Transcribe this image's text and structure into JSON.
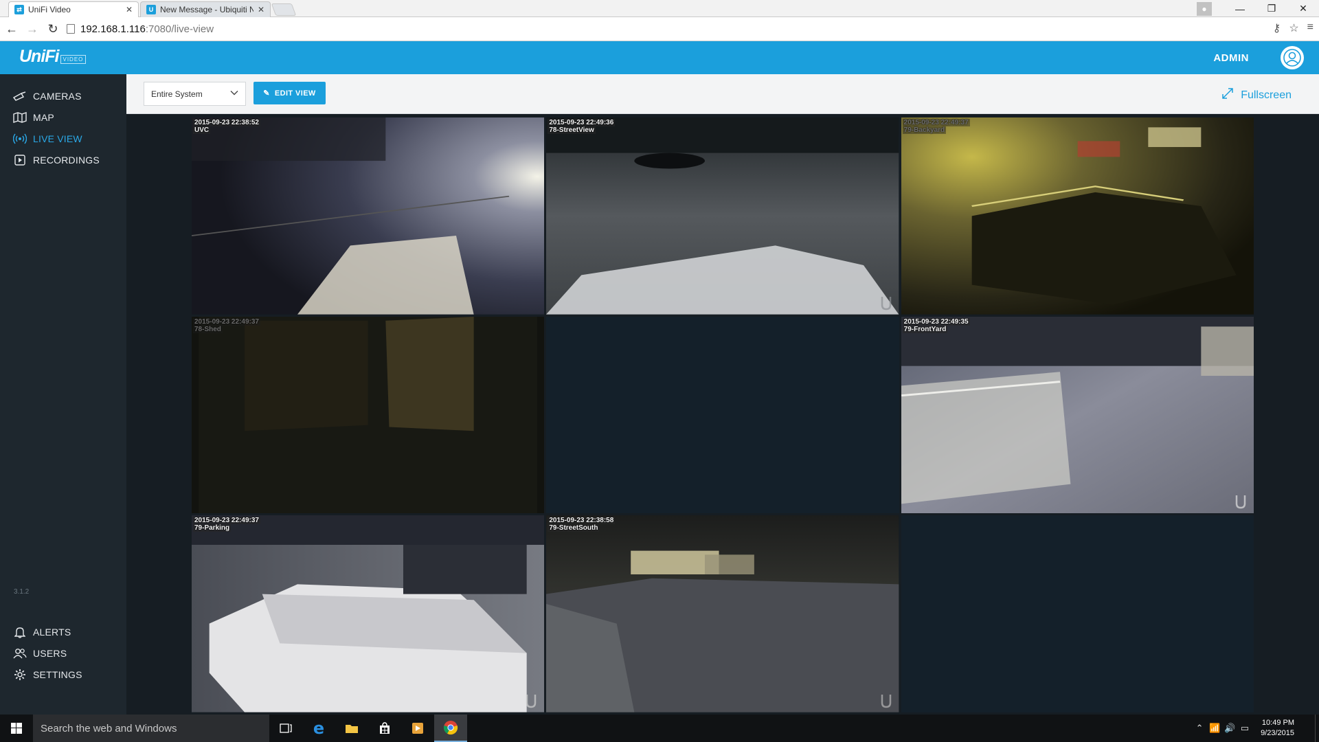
{
  "browser": {
    "tabs": [
      {
        "label": "UniFi Video",
        "favicon": "unifi-icon",
        "active": true
      },
      {
        "label": "New Message - Ubiquiti N",
        "favicon": "ubiquiti-icon",
        "active": false
      }
    ],
    "url_host": "192.168.1.116",
    "url_path": ":7080/live-view"
  },
  "header": {
    "logo_text": "UniFi",
    "logo_badge": "VIDEO",
    "user_label": "ADMIN"
  },
  "sidebar": {
    "items": [
      {
        "label": "CAMERAS",
        "icon": "camera-icon",
        "active": false
      },
      {
        "label": "MAP",
        "icon": "map-icon",
        "active": false
      },
      {
        "label": "LIVE VIEW",
        "icon": "live-view-icon",
        "active": true
      },
      {
        "label": "RECORDINGS",
        "icon": "play-icon",
        "active": false
      }
    ],
    "version": "3.1.2",
    "bottom_items": [
      {
        "label": "ALERTS",
        "icon": "bell-icon"
      },
      {
        "label": "USERS",
        "icon": "users-icon"
      },
      {
        "label": "SETTINGS",
        "icon": "gear-icon"
      }
    ]
  },
  "toolbar": {
    "view_select_value": "Entire System",
    "edit_view_label": "EDIT VIEW",
    "fullscreen_label": "Fullscreen"
  },
  "cameras": [
    {
      "timestamp": "2015-09-23 22:38:52",
      "name": "UVC"
    },
    {
      "timestamp": "2015-09-23 22:49:36",
      "name": "78-StreetView"
    },
    {
      "timestamp": "2015-09-23 22:49:37",
      "name": "79-Backyard"
    },
    {
      "timestamp": "2015-09-23 22:49:37",
      "name": "78-Shed"
    },
    {
      "timestamp": "",
      "name": ""
    },
    {
      "timestamp": "2015-09-23 22:49:35",
      "name": "79-FrontYard"
    },
    {
      "timestamp": "2015-09-23 22:49:37",
      "name": "79-Parking"
    },
    {
      "timestamp": "2015-09-23 22:38:58",
      "name": "79-StreetSouth"
    },
    {
      "timestamp": "",
      "name": ""
    }
  ],
  "taskbar": {
    "search_placeholder": "Search the web and Windows",
    "time": "10:49 PM",
    "date": "9/23/2015"
  }
}
